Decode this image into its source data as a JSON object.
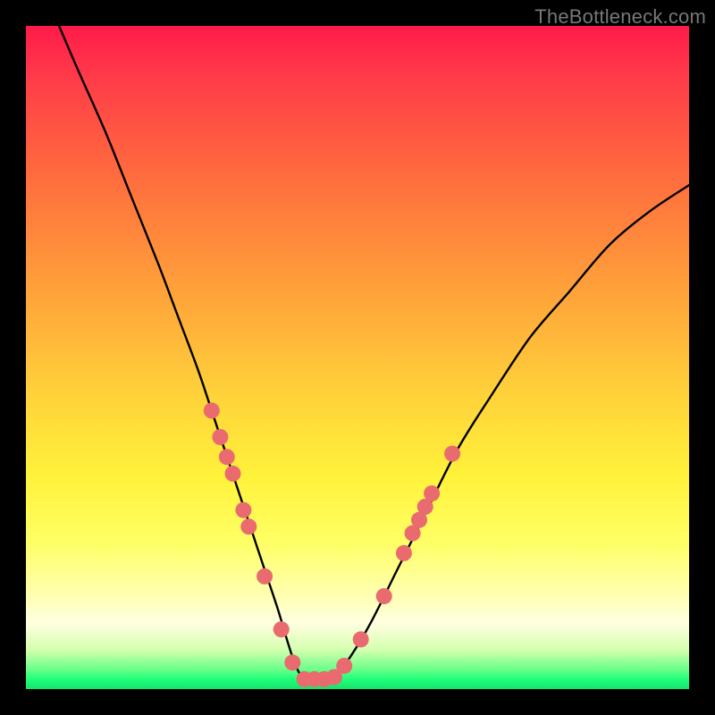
{
  "watermark": "TheBottleneck.com",
  "colors": {
    "frame": "#000000",
    "curve_stroke": "#000000",
    "marker_fill": "#e96a6f",
    "marker_stroke": "#c94e55",
    "gradient": [
      "#ff1a49",
      "#ff3c49",
      "#ff6a3e",
      "#ffa23a",
      "#ffd33a",
      "#fff23a",
      "#ffff66",
      "#ffffb3",
      "#ffffe0",
      "#d6ffb0",
      "#6cff8a",
      "#1fff7a",
      "#16e36b"
    ]
  },
  "chart_data": {
    "type": "line",
    "title": "",
    "xlabel": "",
    "ylabel": "",
    "xlim": [
      0,
      100
    ],
    "ylim": [
      0,
      100
    ],
    "grid": false,
    "legend": false,
    "series": [
      {
        "name": "bottleneck-curve",
        "x": [
          5,
          8,
          12,
          16,
          20,
          23,
          26,
          28,
          30,
          32,
          34,
          36,
          38,
          39.5,
          40.5,
          41.5,
          42.5,
          43.5,
          45,
          47,
          49,
          52,
          56,
          60,
          65,
          70,
          76,
          82,
          88,
          94,
          100
        ],
        "y": [
          100,
          93,
          84,
          74,
          64,
          56,
          48,
          42,
          36,
          30,
          24,
          18,
          12,
          7,
          4,
          2,
          1.5,
          1.5,
          1.5,
          2.5,
          5,
          10,
          18,
          26,
          36,
          44,
          53,
          60,
          67,
          72,
          76
        ]
      }
    ],
    "markers": {
      "name": "highlighted-points",
      "points": [
        {
          "x": 28.0,
          "y": 42.0
        },
        {
          "x": 29.3,
          "y": 38.0
        },
        {
          "x": 30.3,
          "y": 35.0
        },
        {
          "x": 31.2,
          "y": 32.5
        },
        {
          "x": 32.8,
          "y": 27.0
        },
        {
          "x": 33.6,
          "y": 24.5
        },
        {
          "x": 36.0,
          "y": 17.0
        },
        {
          "x": 38.5,
          "y": 9.0
        },
        {
          "x": 40.2,
          "y": 4.0
        },
        {
          "x": 42.0,
          "y": 1.5
        },
        {
          "x": 43.5,
          "y": 1.5
        },
        {
          "x": 45.0,
          "y": 1.5
        },
        {
          "x": 46.5,
          "y": 1.8
        },
        {
          "x": 48.0,
          "y": 3.5
        },
        {
          "x": 50.5,
          "y": 7.5
        },
        {
          "x": 54.0,
          "y": 14.0
        },
        {
          "x": 57.0,
          "y": 20.5
        },
        {
          "x": 58.3,
          "y": 23.5
        },
        {
          "x": 59.3,
          "y": 25.5
        },
        {
          "x": 60.2,
          "y": 27.5
        },
        {
          "x": 61.2,
          "y": 29.5
        },
        {
          "x": 64.3,
          "y": 35.5
        }
      ]
    }
  }
}
